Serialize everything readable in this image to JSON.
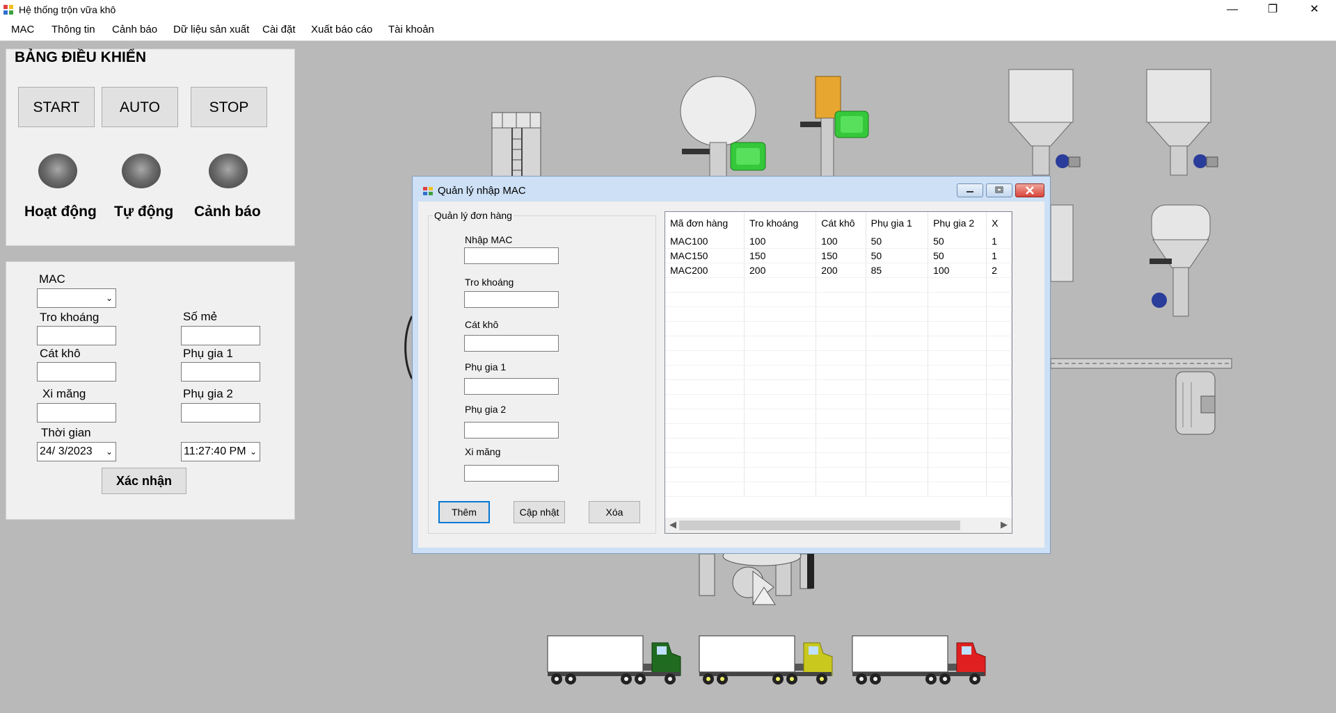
{
  "app": {
    "title": "Hệ thống trộn vữa khô",
    "window_controls": {
      "minimize": "—",
      "restore": "❐",
      "close": "✕"
    }
  },
  "menu": [
    "MAC",
    "Thông tin",
    "Cảnh báo",
    "Dữ liệu sản xuất",
    "Cài đặt",
    "Xuất báo cáo",
    "Tài khoản"
  ],
  "control_panel": {
    "title": "BẢNG ĐIỀU KHIỂN",
    "buttons": {
      "start": "START",
      "auto": "AUTO",
      "stop": "STOP"
    },
    "lamps": {
      "active": "Hoạt động",
      "auto": "Tự động",
      "warning": "Cảnh báo"
    }
  },
  "order_form": {
    "mac_label": "MAC",
    "mac_value": "",
    "tro_khoang_label": "Tro khoáng",
    "so_me_label": "Số mẻ",
    "cat_kho_label": "Cát khô",
    "phu_gia_1_label": "Phụ gia 1",
    "xi_mang_label": "Xi măng",
    "phu_gia_2_label": "Phụ gia 2",
    "thoi_gian_label": "Thời gian",
    "date_value": "24/  3/2023",
    "time_value": "11:27:40 PM",
    "confirm_button": "Xác nhận"
  },
  "dialog": {
    "title": "Quản lý nhập MAC",
    "group_title": "Quản lý đơn hàng",
    "fields": {
      "nhap_mac": "Nhập MAC",
      "tro_khoang": "Tro khoáng",
      "cat_kho": "Cát khô",
      "phu_gia_1": "Phụ gia 1",
      "phu_gia_2": "Phụ gia 2",
      "xi_mang": "Xi măng"
    },
    "buttons": {
      "add": "Thêm",
      "update": "Cập nhật",
      "delete": "Xóa"
    },
    "table": {
      "headers": [
        "Mã đơn hàng",
        "Tro khoáng",
        "Cát khô",
        "Phụ gia 1",
        "Phụ gia 2",
        "X"
      ],
      "rows": [
        [
          "MAC100",
          "100",
          "100",
          "50",
          "50",
          "1"
        ],
        [
          "MAC150",
          "150",
          "150",
          "50",
          "50",
          "1"
        ],
        [
          "MAC200",
          "200",
          "200",
          "85",
          "100",
          "2"
        ]
      ]
    }
  },
  "colors": {
    "workspace": "#b9b9b9",
    "panel": "#f0f0f0",
    "dialog_frame": "#cde0f5",
    "close_button": "#d9443b",
    "motor_green": "#35c83a",
    "truck_green": "#1f6b1f",
    "truck_yellow": "#c8c81e",
    "truck_red": "#e02020"
  }
}
